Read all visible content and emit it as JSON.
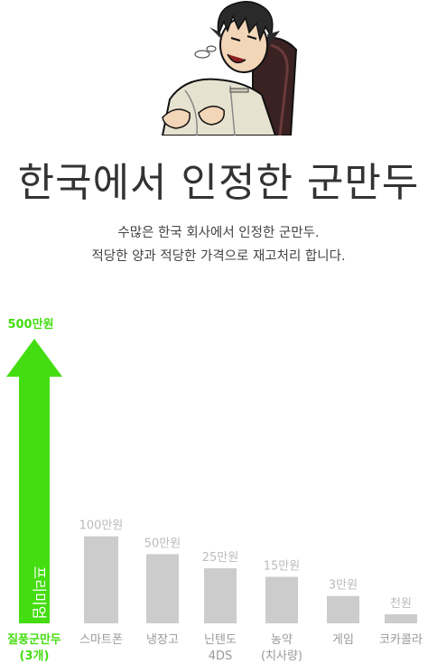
{
  "header": {
    "title": "한국에서 인정한 군만두",
    "subtitle_lines": [
      "수많은 한국 회사에서 인정한 군만두.",
      "적당한 양과 적당한 가격으로 재고처리 합니다."
    ]
  },
  "colors": {
    "highlight": "#44dd11",
    "bar": "#cccccc",
    "muted_label": "#bbbbbb",
    "category_label": "#999999"
  },
  "chart_data": {
    "type": "bar",
    "title": "",
    "xlabel": "",
    "ylabel": "",
    "categories": [
      [
        "질풍군만두",
        "(3개)"
      ],
      [
        "스마트폰"
      ],
      [
        "냉장고"
      ],
      [
        "닌텐도",
        "4DS"
      ],
      [
        "농약",
        "(치사량)"
      ],
      [
        "게임"
      ],
      [
        "코카콜라"
      ]
    ],
    "values": [
      5000000,
      1000000,
      500000,
      250000,
      150000,
      30000,
      1000
    ],
    "value_labels": [
      "500만원",
      "100만원",
      "50만원",
      "25만원",
      "15만원",
      "3만원",
      "천원"
    ],
    "highlight_index": 0,
    "highlight_bar_text": "프리미엄",
    "ylim": [
      0,
      5000000
    ],
    "scale": "nonlinear"
  }
}
